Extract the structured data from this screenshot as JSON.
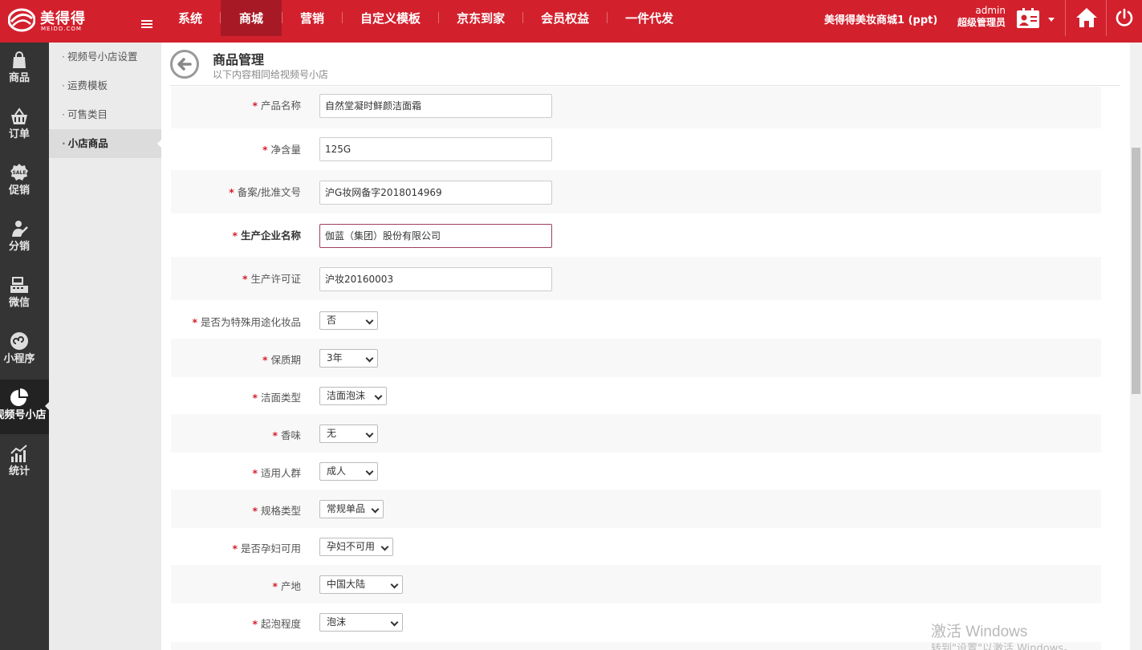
{
  "brand": {
    "name": "美得得",
    "sub": "MEIDD.COM"
  },
  "colors": {
    "primary": "#d3202d",
    "sidebar": "#343434",
    "subbar": "#ebebeb"
  },
  "nav": [
    {
      "label": "系统"
    },
    {
      "label": "商城",
      "active": true
    },
    {
      "label": "营销"
    },
    {
      "label": "自定义模板"
    },
    {
      "label": "京东到家"
    },
    {
      "label": "会员权益"
    },
    {
      "label": "一件代发"
    }
  ],
  "header": {
    "shop_name": "美得得美妆商城1 (ppt)",
    "user_name": "admin",
    "user_role": "超级管理员",
    "icons": [
      "user-card-icon",
      "home-icon",
      "power-icon"
    ]
  },
  "sidebar": [
    {
      "label": "商品",
      "icon": "bag-icon"
    },
    {
      "label": "订单",
      "icon": "basket-icon"
    },
    {
      "label": "促销",
      "icon": "sale-icon"
    },
    {
      "label": "分销",
      "icon": "distribution-icon"
    },
    {
      "label": "微信",
      "icon": "register-icon"
    },
    {
      "label": "小程序",
      "icon": "mini-program-icon"
    },
    {
      "label": "视频号小店",
      "icon": "pie-icon",
      "active": true
    },
    {
      "label": "统计",
      "icon": "stats-icon"
    }
  ],
  "subnav": [
    {
      "label": "视频号小店设置"
    },
    {
      "label": "运费模板"
    },
    {
      "label": "可售类目"
    },
    {
      "label": "小店商品",
      "active": true
    }
  ],
  "page": {
    "title": "商品管理",
    "subtitle": "以下内容相同给视频号小店"
  },
  "form": {
    "product_name": {
      "label": "产品名称",
      "value": "自然堂凝时鲜颜洁面霜"
    },
    "net_content": {
      "label": "净含量",
      "value": "125G"
    },
    "record_no": {
      "label": "备案/批准文号",
      "value": "沪G妆网备字2018014969"
    },
    "manufacturer": {
      "label": "生产企业名称",
      "value": "伽蓝（集团）股份有限公司"
    },
    "license": {
      "label": "生产许可证",
      "value": "沪妆20160003"
    },
    "special_use": {
      "label": "是否为特殊用途化妆品",
      "value": "否"
    },
    "shelf_life": {
      "label": "保质期",
      "value": "3年"
    },
    "cleanser_type": {
      "label": "洁面类型",
      "value": "洁面泡沫"
    },
    "fragrance": {
      "label": "香味",
      "value": "无"
    },
    "audience": {
      "label": "适用人群",
      "value": "成人"
    },
    "spec_type": {
      "label": "规格类型",
      "value": "常规单品"
    },
    "pregnant": {
      "label": "是否孕妇可用",
      "value": "孕妇不可用"
    },
    "origin": {
      "label": "产地",
      "value": "中国大陆"
    },
    "foam_level": {
      "label": "起泡程度",
      "value": "泡沫"
    }
  },
  "watermark": {
    "line1": "激活 Windows",
    "line2": "转到\"设置\"以激活 Windows。"
  }
}
